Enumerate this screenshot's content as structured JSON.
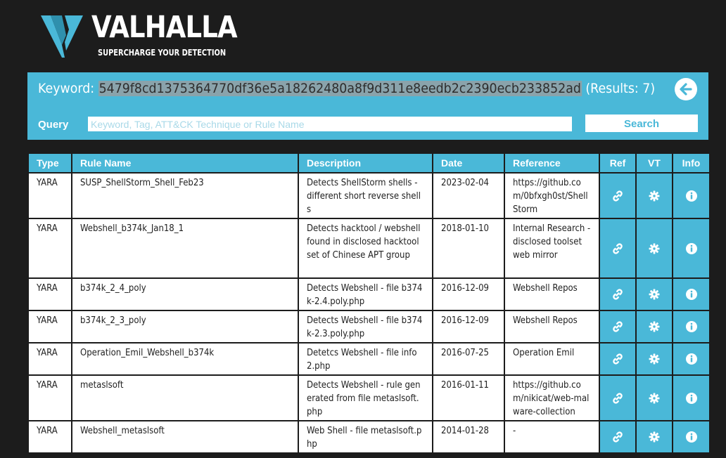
{
  "brand": {
    "name": "VALHALLA",
    "tagline": "SUPERCHARGE YOUR DETECTION"
  },
  "search": {
    "keyword_label": "Keyword:",
    "keyword_value": "5479f8cd1375364770df36e5a18262480a8f9d311e8eedb2c2390ecb233852ad",
    "results_text": "(Results: 7)",
    "query_label": "Query",
    "placeholder": "Keyword, Tag, ATT&CK Technique or Rule Name",
    "query_value": "",
    "button_label": "Search"
  },
  "table": {
    "headers": {
      "type": "Type",
      "rule_name": "Rule Name",
      "description": "Description",
      "date": "Date",
      "reference": "Reference",
      "ref": "Ref",
      "vt": "VT",
      "info": "Info"
    },
    "rows": [
      {
        "type": "YARA",
        "rule_name": "SUSP_ShellStorm_Shell_Feb23",
        "description": "Detects ShellStorm shells - different short reverse shells",
        "date": "2023-02-04",
        "reference": "https://github.com/0bfxgh0st/ShellStorm"
      },
      {
        "type": "YARA",
        "rule_name": "Webshell_b374k_Jan18_1",
        "description": "Detects hacktool / webshell found in disclosed hacktool set of Chinese APT group",
        "date": "2018-01-10",
        "reference": "Internal Research - disclosed toolset web mirror"
      },
      {
        "type": "YARA",
        "rule_name": "b374k_2_4_poly",
        "description": "Detects Webshell - file b374k-2.4.poly.php",
        "date": "2016-12-09",
        "reference": "Webshell Repos"
      },
      {
        "type": "YARA",
        "rule_name": "b374k_2_3_poly",
        "description": "Detects Webshell - file b374k-2.3.poly.php",
        "date": "2016-12-09",
        "reference": "Webshell Repos"
      },
      {
        "type": "YARA",
        "rule_name": "Operation_Emil_Webshell_b374k",
        "description": "Detetcs Webshell - file info2.php",
        "date": "2016-07-25",
        "reference": "Operation Emil"
      },
      {
        "type": "YARA",
        "rule_name": "metaslsoft",
        "description": "Detects Webshell - rule generated from file metaslsoft.php",
        "date": "2016-01-11",
        "reference": "https://github.com/nikicat/web-malware-collection"
      },
      {
        "type": "YARA",
        "rule_name": "Webshell_metaslsoft",
        "description": "Web Shell - file metaslsoft.php",
        "date": "2014-01-28",
        "reference": "-"
      }
    ],
    "action_icons": {
      "ref": "link-icon",
      "vt": "gear-icon",
      "info": "info-icon"
    }
  },
  "colors": {
    "accent": "#4ab8d8",
    "background": "#1c1c1c",
    "hash_highlight": "#8aa3ab"
  }
}
